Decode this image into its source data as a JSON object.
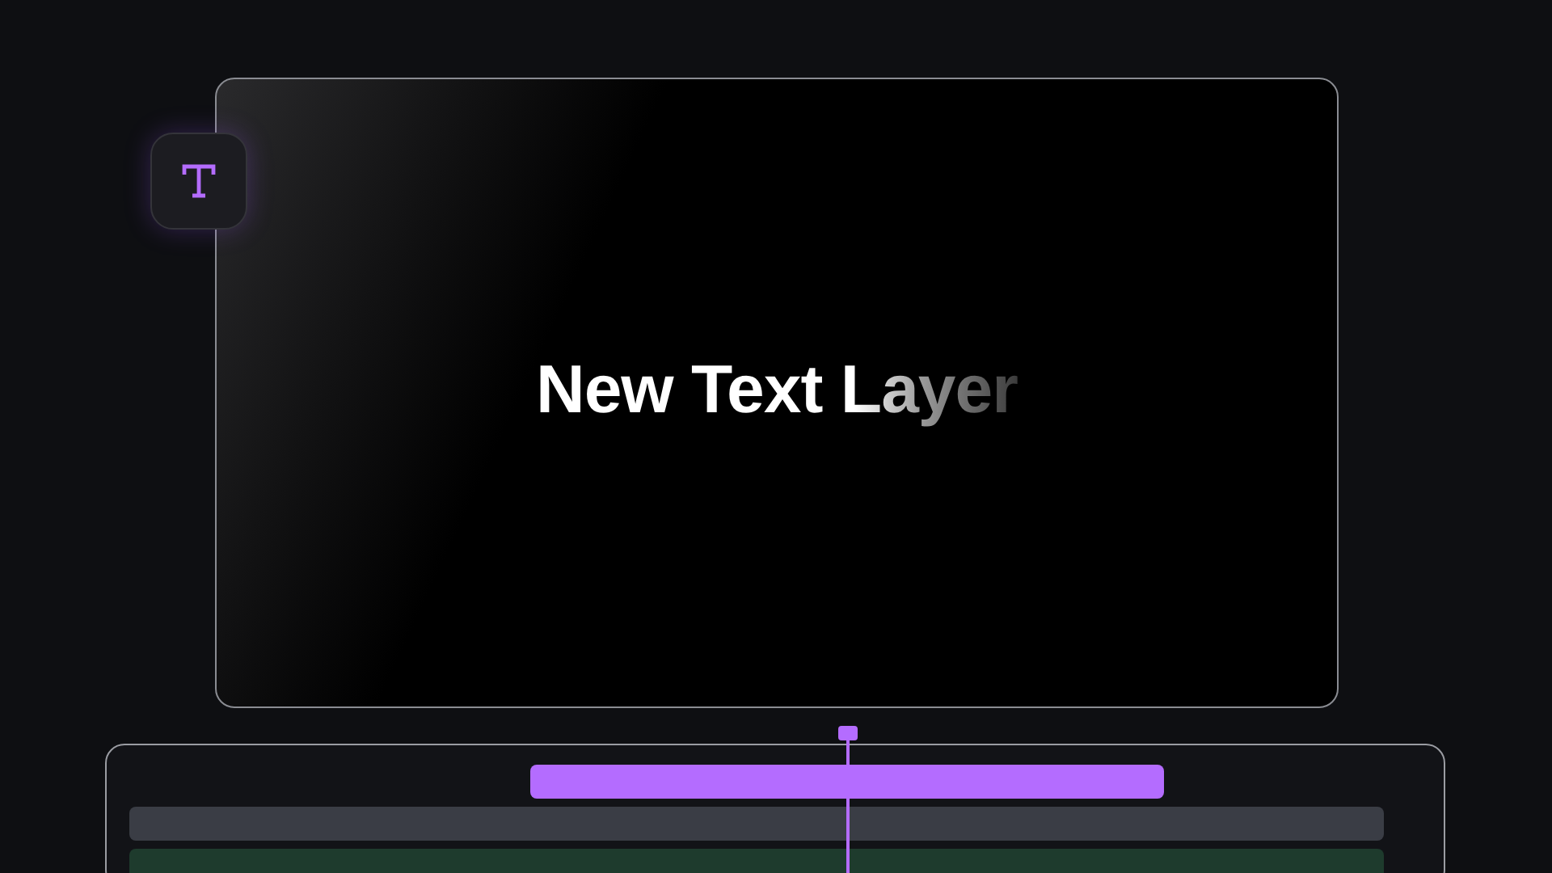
{
  "preview": {
    "text": "New Text Layer"
  },
  "timeline": {
    "clips": [
      {
        "kind": "text",
        "color": "#b46cff"
      },
      {
        "kind": "track",
        "color": "#3a3d45"
      },
      {
        "kind": "track",
        "color": "#1e3b2d"
      }
    ]
  }
}
